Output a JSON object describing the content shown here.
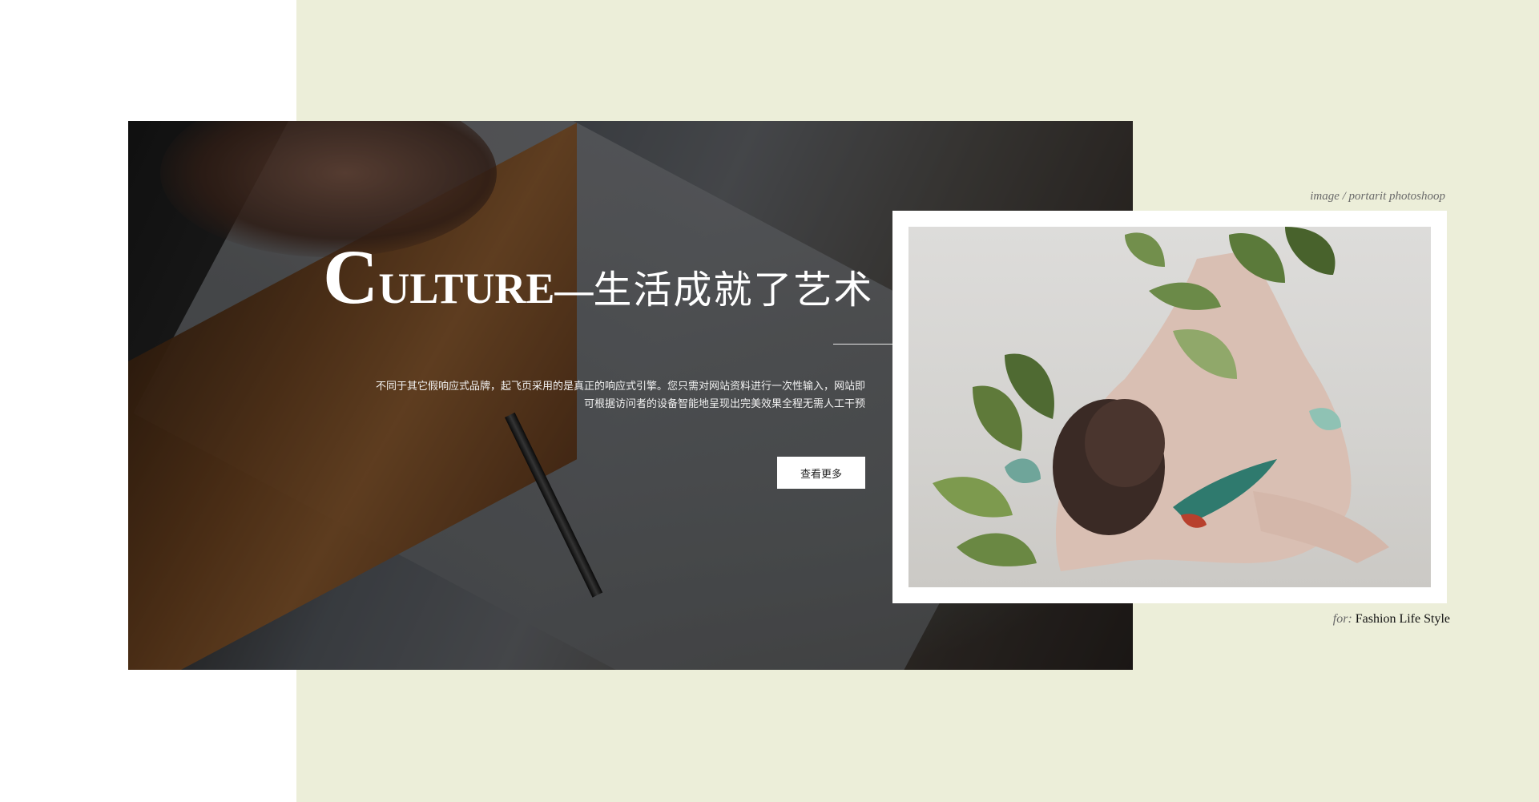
{
  "hero": {
    "headline_cap": "C",
    "headline_rest": "ULTURE",
    "headline_dash": "—",
    "headline_cn": "生活成就了艺术",
    "description": "不同于其它假响应式品牌，起飞页采用的是真正的响应式引擎。您只需对网站资料进行一次性输入，网站即可根据访问者的设备智能地呈现出完美效果全程无需人工干预",
    "button_label": "查看更多"
  },
  "aside": {
    "image_label": "image / portarit photoshoop",
    "caption_prefix": "for:",
    "caption_text": "Fashion Life Style"
  },
  "colors": {
    "panel_bg": "#eceed9",
    "button_bg": "#ffffff",
    "headline_text": "#ffffff"
  }
}
